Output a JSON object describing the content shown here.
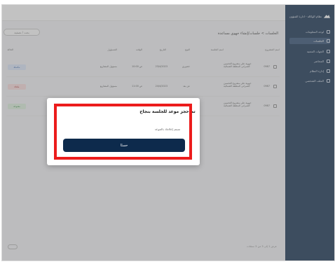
{
  "sidebar": {
    "brand": "نظام الوكالة - ادارة الشؤون",
    "items": [
      {
        "label": "لوحة المعلومات",
        "active": false
      },
      {
        "label": "الجلسات",
        "active": true
      },
      {
        "label": "الجهات المعنية",
        "active": false
      },
      {
        "label": "المحاضر",
        "active": false
      },
      {
        "label": "إدارة النظام",
        "active": false
      },
      {
        "label": "الملف الشخصي",
        "active": false
      }
    ]
  },
  "main": {
    "page_title": "الجلسات > جلسات/إنشاء جهوي مساعدة",
    "search_button": "بحث / تصفية",
    "table_headers": [
      "اسم المشروع",
      "اسم الجلسة",
      "النوع",
      "التاريخ",
      "الوقت",
      "المسؤول",
      "الحالة"
    ],
    "rows": [
      {
        "id": "0987",
        "name": "جهوية علي مشروع التحسين العمراني المنطقة الشمالية",
        "type": "حضوري",
        "date": "23/4/2023",
        "time": "10:00 ص",
        "owner": "مسؤول المشاريع",
        "status": "مكتملة"
      },
      {
        "id": "0987",
        "name": "جهوية علي مشروع التحسين العمراني المنطقة الشمالية",
        "type": "عن بعد",
        "date": "24/4/2023",
        "time": "11:00 ص",
        "owner": "مسؤول المشاريع",
        "status": "ملغاة"
      },
      {
        "id": "0987",
        "name": "جهوية علي مشروع التحسين العمراني المنطقة الشمالية",
        "type": "حضوري",
        "date": "25/4/2023",
        "time": "10:00 ص",
        "owner": "مسؤول المشاريع",
        "status": "مفتوحة"
      }
    ],
    "footer": "عرض 1 إلى 3 من 3 سجلات"
  },
  "modal": {
    "title": "تم حجز موعد للجلسة بنجاح",
    "subtitle": "سيتم إعلامك بالموعد",
    "ok_button": "حسنًا"
  },
  "colors": {
    "sidebar": "#0d2a4c",
    "button": "#0d2a4c",
    "highlight": "#ec1c1c"
  }
}
